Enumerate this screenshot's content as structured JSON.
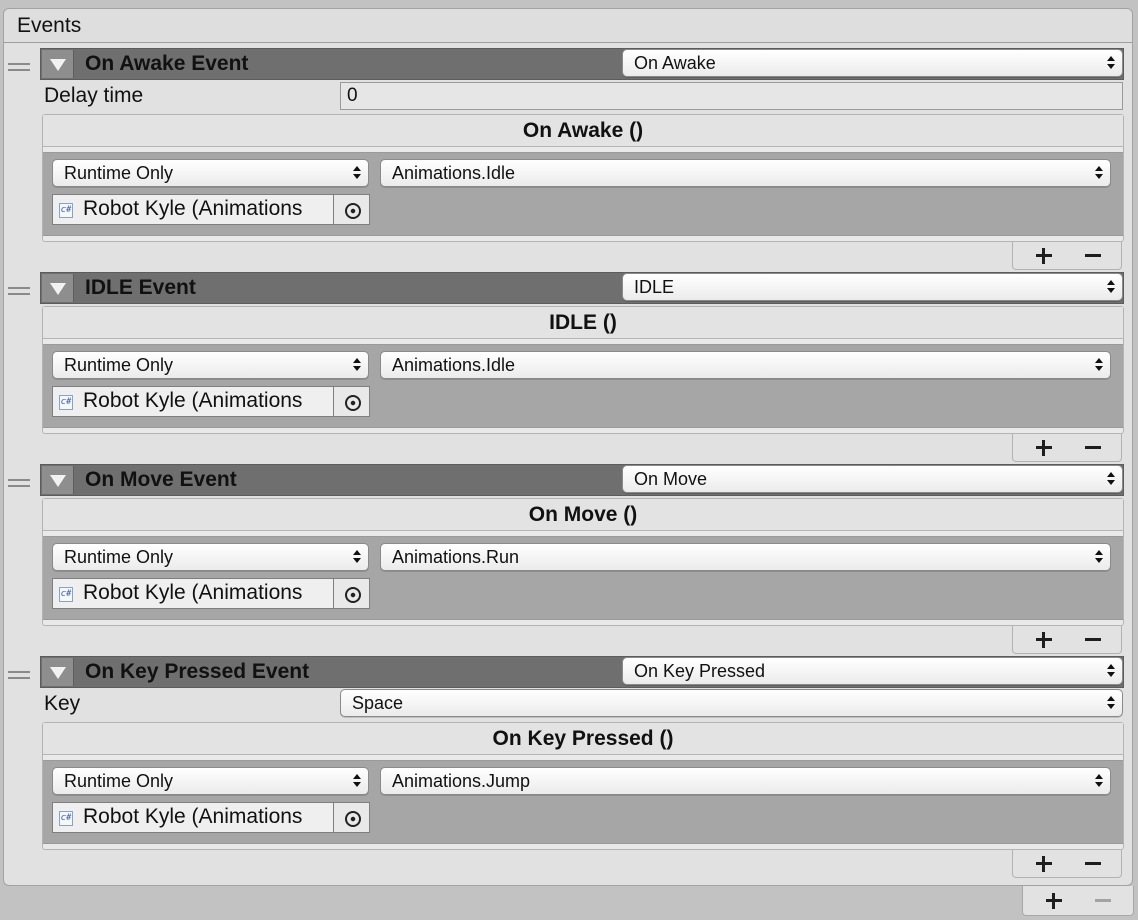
{
  "panel": {
    "title": "Events"
  },
  "events": [
    {
      "header_title": "On Awake Event",
      "type_dropdown": "On Awake",
      "extra_field": {
        "label": "Delay time",
        "value": "0",
        "kind": "text"
      },
      "unity_event_title": "On Awake ()",
      "listener": {
        "runtime": "Runtime Only",
        "method": "Animations.Idle",
        "object": "Robot Kyle (Animations"
      }
    },
    {
      "header_title": "IDLE Event",
      "type_dropdown": "IDLE",
      "unity_event_title": "IDLE ()",
      "listener": {
        "runtime": "Runtime Only",
        "method": "Animations.Idle",
        "object": "Robot Kyle (Animations"
      }
    },
    {
      "header_title": "On Move Event",
      "type_dropdown": "On Move",
      "unity_event_title": "On Move ()",
      "listener": {
        "runtime": "Runtime Only",
        "method": "Animations.Run",
        "object": "Robot Kyle (Animations"
      }
    },
    {
      "header_title": "On Key Pressed Event",
      "type_dropdown": "On Key Pressed",
      "extra_field": {
        "label": "Key",
        "value": "Space",
        "kind": "dropdown"
      },
      "unity_event_title": "On Key Pressed ()",
      "listener": {
        "runtime": "Runtime Only",
        "method": "Animations.Jump",
        "object": "Robot Kyle (Animations"
      }
    }
  ],
  "icons": {
    "script": "csharp-script-icon",
    "picker": "object-picker-icon",
    "add": "plus-icon",
    "remove": "minus-icon",
    "foldout": "foldout-triangle-icon",
    "drag": "drag-handle-icon"
  },
  "colors": {
    "event_header_bg": "#6f6f6f",
    "listener_body_bg": "#a6a6a6",
    "panel_bg": "#e1e1e1"
  }
}
